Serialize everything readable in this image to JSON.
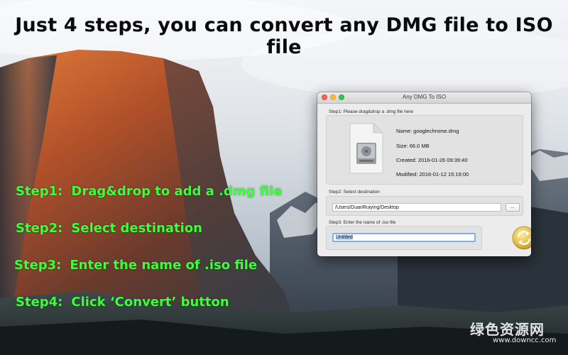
{
  "headline": "Just 4 steps, you can convert any DMG file to ISO file",
  "steps": [
    {
      "num": "Step1:",
      "text": "Drag&drop to add a .dmg file"
    },
    {
      "num": "Step2:",
      "text": "Select destination"
    },
    {
      "num": "Step3:",
      "text": "Enter the name of .iso file"
    },
    {
      "num": "Step4:",
      "text": "Click ‘Convert’ button"
    }
  ],
  "window": {
    "title": "Any DMG To ISO",
    "step1_label": "Step1: Please drag&drop a .dmg file here",
    "file": {
      "name": "Name: googlechrome.dmg",
      "size": "Size: 66.0 MB",
      "created": "Created: 2016-01-26 09:39:40",
      "modified": "Modified: 2016-01-12 15:19:00"
    },
    "step2_label": "Step2: Select destination",
    "destination_path": "/Users/DuanRuiying/Desktop",
    "browse_label": "...",
    "step3_label": "Step3: Enter the name of .iso file",
    "iso_name": "Untitled"
  },
  "icons": {
    "file": "dmg-file-icon",
    "convert": "convert-refresh-icon"
  },
  "colors": {
    "step_text": "#3bff3b",
    "convert_button": "#e6c24a",
    "name_field_focus": "#7fb0ea"
  },
  "watermark": {
    "brand": "绿色资源网",
    "url": "www.downcc.com"
  }
}
